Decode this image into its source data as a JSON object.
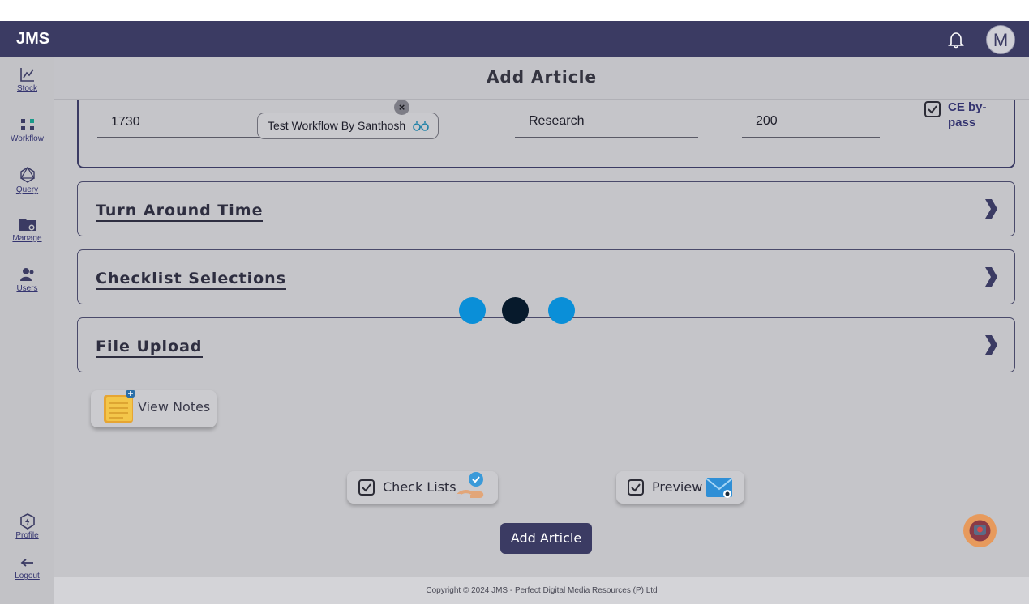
{
  "app": {
    "brand": "JMS"
  },
  "sidebar": {
    "items": [
      {
        "label": "Stock"
      },
      {
        "label": "Workflow"
      },
      {
        "label": "Query"
      },
      {
        "label": "Manage"
      },
      {
        "label": "Users"
      },
      {
        "label": "Profile"
      },
      {
        "label": "Logout"
      }
    ]
  },
  "topbar": {
    "avatar_letter": "M"
  },
  "page": {
    "title": "Add Article"
  },
  "form": {
    "field1_value": "1730",
    "workflow_chip": "Test Workflow By Santhosh",
    "chip_close": "×",
    "article_type_value": "Research",
    "field4_value": "200",
    "ce_bypass_label": "CE by-pass",
    "ce_bypass_checked": true
  },
  "accordions": [
    {
      "title": "Turn Around Time"
    },
    {
      "title": "Checklist Selections"
    },
    {
      "title": "File Upload"
    }
  ],
  "loader": {
    "colors": [
      "#0a8fd8",
      "#071a2c",
      "#0a8fd8"
    ]
  },
  "actions": {
    "view_notes": "View Notes",
    "check_lists": "Check Lists",
    "check_lists_checked": true,
    "preview": "Preview",
    "preview_checked": true,
    "add_article": "Add Article"
  },
  "footer": {
    "copyright": "Copyright © 2024 JMS - Perfect Digital Media Resources (P) Ltd"
  },
  "colors": {
    "primary": "#3b3b63",
    "overlay_bg": "#c5c5c9",
    "fab": "#e79a5c"
  }
}
